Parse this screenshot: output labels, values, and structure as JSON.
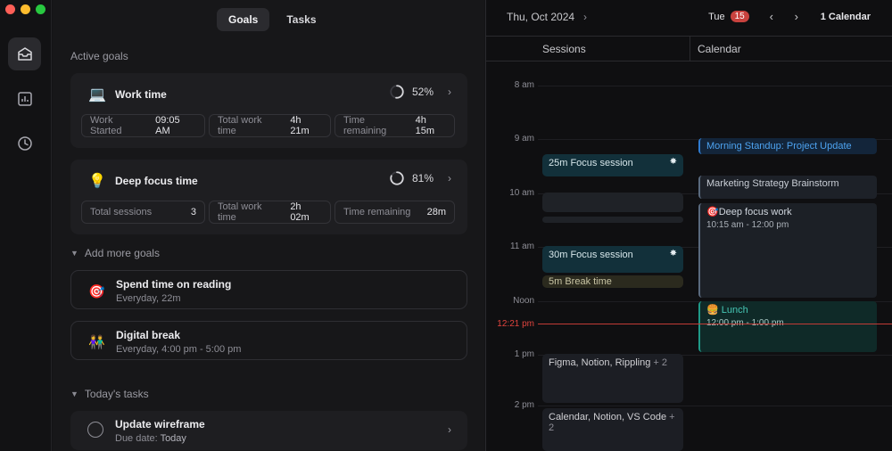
{
  "sidebar": {
    "items": [
      {
        "icon": "inbox-icon",
        "active": true
      },
      {
        "icon": "chart-icon",
        "active": false
      },
      {
        "icon": "clock-icon",
        "active": false
      }
    ]
  },
  "tabs": {
    "goals": "Goals",
    "tasks": "Tasks"
  },
  "active_goals": {
    "label": "Active goals",
    "goals": [
      {
        "emoji": "💻",
        "title": "Work time",
        "percent": "52%",
        "progress": 0.52,
        "stats": [
          {
            "key": "Work Started",
            "value": "09:05 AM"
          },
          {
            "key": "Total work time",
            "value": "4h 21m"
          },
          {
            "key": "Time remaining",
            "value": "4h 15m"
          }
        ]
      },
      {
        "emoji": "💡",
        "title": "Deep focus time",
        "percent": "81%",
        "progress": 0.81,
        "stats": [
          {
            "key": "Total sessions",
            "value": "3"
          },
          {
            "key": "Total work time",
            "value": "2h 02m"
          },
          {
            "key": "Time remaining",
            "value": "28m"
          }
        ]
      }
    ]
  },
  "more_goals": {
    "label": "Add more goals",
    "items": [
      {
        "emoji": "🎯",
        "title": "Spend time on reading",
        "subtitle": "Everyday, 22m"
      },
      {
        "emoji": "👫",
        "title": "Digital break",
        "subtitle": "Everyday, 4:00 pm - 5:00 pm"
      }
    ]
  },
  "todays_tasks": {
    "label": "Today's tasks",
    "items": [
      {
        "title": "Update wireframe",
        "due_label": "Due date:",
        "due_value": "Today"
      }
    ]
  },
  "calendar": {
    "date": "Thu, Oct 2024",
    "day": "Tue",
    "badge": "15",
    "calendar_name": "1 Calendar",
    "col_sessions": "Sessions",
    "col_calendar": "Calendar",
    "hours": [
      "8 am",
      "9 am",
      "10 am",
      "11 am",
      "Noon",
      "1 pm",
      "2 pm"
    ],
    "now": "12:21 pm",
    "sessions": [
      {
        "title": "25m Focus session"
      },
      {
        "title": "30m Focus session"
      },
      {
        "title": "5m Break time"
      },
      {
        "title": "Figma, Notion, Rippling",
        "more": "+ 2"
      },
      {
        "title": "Calendar, Notion, VS Code",
        "more": "+ 2"
      }
    ],
    "events": [
      {
        "title": "Morning Standup: Project Update"
      },
      {
        "title": "Marketing Strategy Brainstorm"
      },
      {
        "emoji": "🎯",
        "title": "Deep focus work",
        "time": "10:15 am - 12:00 pm"
      },
      {
        "emoji": "🍔",
        "title": "Lunch",
        "time": "12:00 pm - 1:00 pm"
      }
    ]
  }
}
